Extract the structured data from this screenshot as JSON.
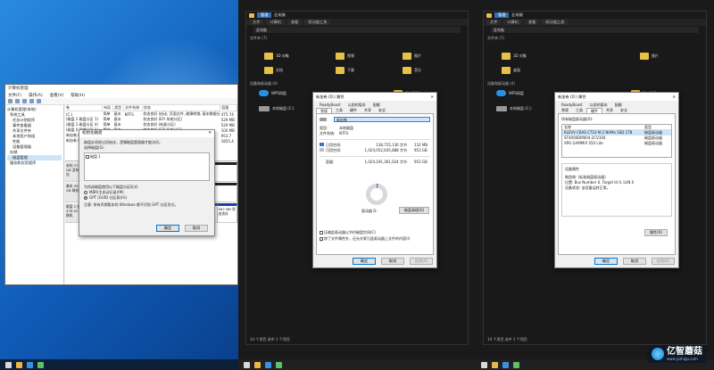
{
  "disk_mgmt": {
    "title": "计算机管理",
    "menu": [
      "文件(F)",
      "操作(A)",
      "查看(V)",
      "帮助(H)"
    ],
    "tree": [
      "计算机管理(本地)",
      "系统工具",
      "任务计划程序",
      "事件查看器",
      "共享文件夹",
      "本地用户和组",
      "性能",
      "设备管理器",
      "存储",
      "磁盘管理",
      "服务和应用程序"
    ],
    "vol_headers": [
      "卷",
      "布局",
      "类型",
      "文件系统",
      "状态",
      "容量"
    ],
    "volumes": [
      [
        "(C:)",
        "简单",
        "基本",
        "NTFS",
        "状态良好 (启动, 页面文件, 故障转储, 基本数据分区)",
        "475.74"
      ],
      [
        "(磁盘 2 磁盘分区 1)",
        "简单",
        "基本",
        "",
        "状态良好 (EFI 系统分区)",
        "529 MB"
      ],
      [
        "(磁盘 2 磁盘分区 4)",
        "简单",
        "基本",
        "",
        "状态良好 (恢复分区)",
        "529 MB"
      ],
      [
        "(磁盘 0 磁盘分区 1)",
        "简单",
        "基本",
        "",
        "状态良好 (EFI 系统分区)",
        "100 MB"
      ],
      [
        "新加卷 (D:)",
        "简单",
        "基本",
        "NTFS",
        "状态良好 (基本数据分区)",
        "953.7"
      ],
      [
        "新加卷 (E:)",
        "简单",
        "基本",
        "NTFS",
        "状态良好 (基本数据分区)",
        "1855.4"
      ]
    ],
    "disk_rows": [
      {
        "label": "未知 3726.02 GB 没有初始化",
        "parts": [
          {
            "t": "3726.02 GB 未分配",
            "un": true
          }
        ]
      },
      {
        "label": "基本 953.87 GB 联机",
        "parts": [
          {
            "t": "953.87 GB 未分配",
            "un": true
          }
        ]
      },
      {
        "label": "磁盘 2 基本 476.92 GB 联机",
        "parts": [
          {
            "t": "529 MB 状态良好"
          },
          {
            "t": "(C:) 475.74 GB NTFS 状态良好"
          },
          {
            "t": "582 MB 状态良好"
          }
        ]
      }
    ]
  },
  "init_dialog": {
    "title": "初始化磁盘",
    "intro": "磁盘必须经过初始化，逻辑磁盘管理器才能访问。",
    "select_label": "选择磁盘(S):",
    "disk_item": "磁盘 1",
    "style_label": "为所选磁盘使用以下磁盘分区形式:",
    "mbr": "MBR(主启动记录)(M)",
    "gpt": "GPT (GUID 分区表)(G)",
    "note": "注意: 所有早期版本的 Windows 都不识别 GPT 分区形式。",
    "ok": "确定",
    "cancel": "取消"
  },
  "explorer": {
    "tabs": [
      "管理",
      "此电脑"
    ],
    "ribbon": [
      "文件",
      "计算机",
      "查看",
      "驱动器工具"
    ],
    "path": "此电脑",
    "section_folders": "文件夹 (7)",
    "section_devices": "设备和驱动器 (4)",
    "folders": [
      "3D 对象",
      "视频",
      "图片",
      "文档",
      "下载",
      "音乐",
      "桌面"
    ],
    "devices": [
      "WPS网盘",
      "百度网盘",
      "本地磁盘 (C:)",
      "新加卷 (D:)"
    ],
    "status": "14 个项目    选中 1 个项目"
  },
  "props_general": {
    "title": "新加卷 (D:) 属性",
    "tabs_row1": [
      "ReadyBoost",
      "以前的版本",
      "配额"
    ],
    "tabs_row2": [
      "常规",
      "工具",
      "硬件",
      "共享",
      "安全"
    ],
    "name_value": "新加卷",
    "type_k": "类型:",
    "type_v": "本地磁盘",
    "fs_k": "文件系统:",
    "fs_v": "NTFS",
    "used_k": "已用空间:",
    "used_b": "138,715,136 字节",
    "used_h": "132 MB",
    "free_k": "可用空间:",
    "free_b": "1,024,052,645,888 字节",
    "free_h": "953 GB",
    "cap_k": "容量:",
    "cap_b": "1,024,191,361,024 字节",
    "cap_h": "953 GB",
    "drive_label": "驱动器 D:",
    "cleanup": "磁盘清理(D)",
    "compress": "压缩此驱动器以节约磁盘空间(C)",
    "index": "除了文件属性外，还允许索引此驱动器上文件的内容(I)",
    "ok": "确定",
    "cancel": "取消",
    "apply": "应用(A)"
  },
  "props_hw": {
    "title": "新加卷 (D:) 属性",
    "tabs_row1": [
      "ReadyBoost",
      "以前的版本",
      "配额"
    ],
    "tabs_row2": [
      "常规",
      "工具",
      "硬件",
      "共享",
      "安全"
    ],
    "disks_label": "所有磁盘驱动器(D):",
    "col_name": "名称",
    "col_type": "类型",
    "drives": [
      [
        "KLEVV CRAS C710 M.2 NVMe SSD 1TB",
        "磁盘驱动器"
      ],
      [
        "ST4000DM004-2CV104",
        "磁盘驱动器"
      ],
      [
        "XPG GAMMIX S50 Lite",
        "磁盘驱动器"
      ]
    ],
    "props_group": "设备属性",
    "maker": "制造商: (标准磁盘驱动器)",
    "location": "位置: Bus Number 0, Target Id 0, LUN 0",
    "status": "设备状态: 该设备运转正常。",
    "prop_btn": "属性(R)",
    "ok": "确定",
    "cancel": "取消",
    "apply": "应用(A)"
  },
  "watermark": {
    "brand": "亿智蘑菇",
    "site": "www.yizhigu.com"
  }
}
